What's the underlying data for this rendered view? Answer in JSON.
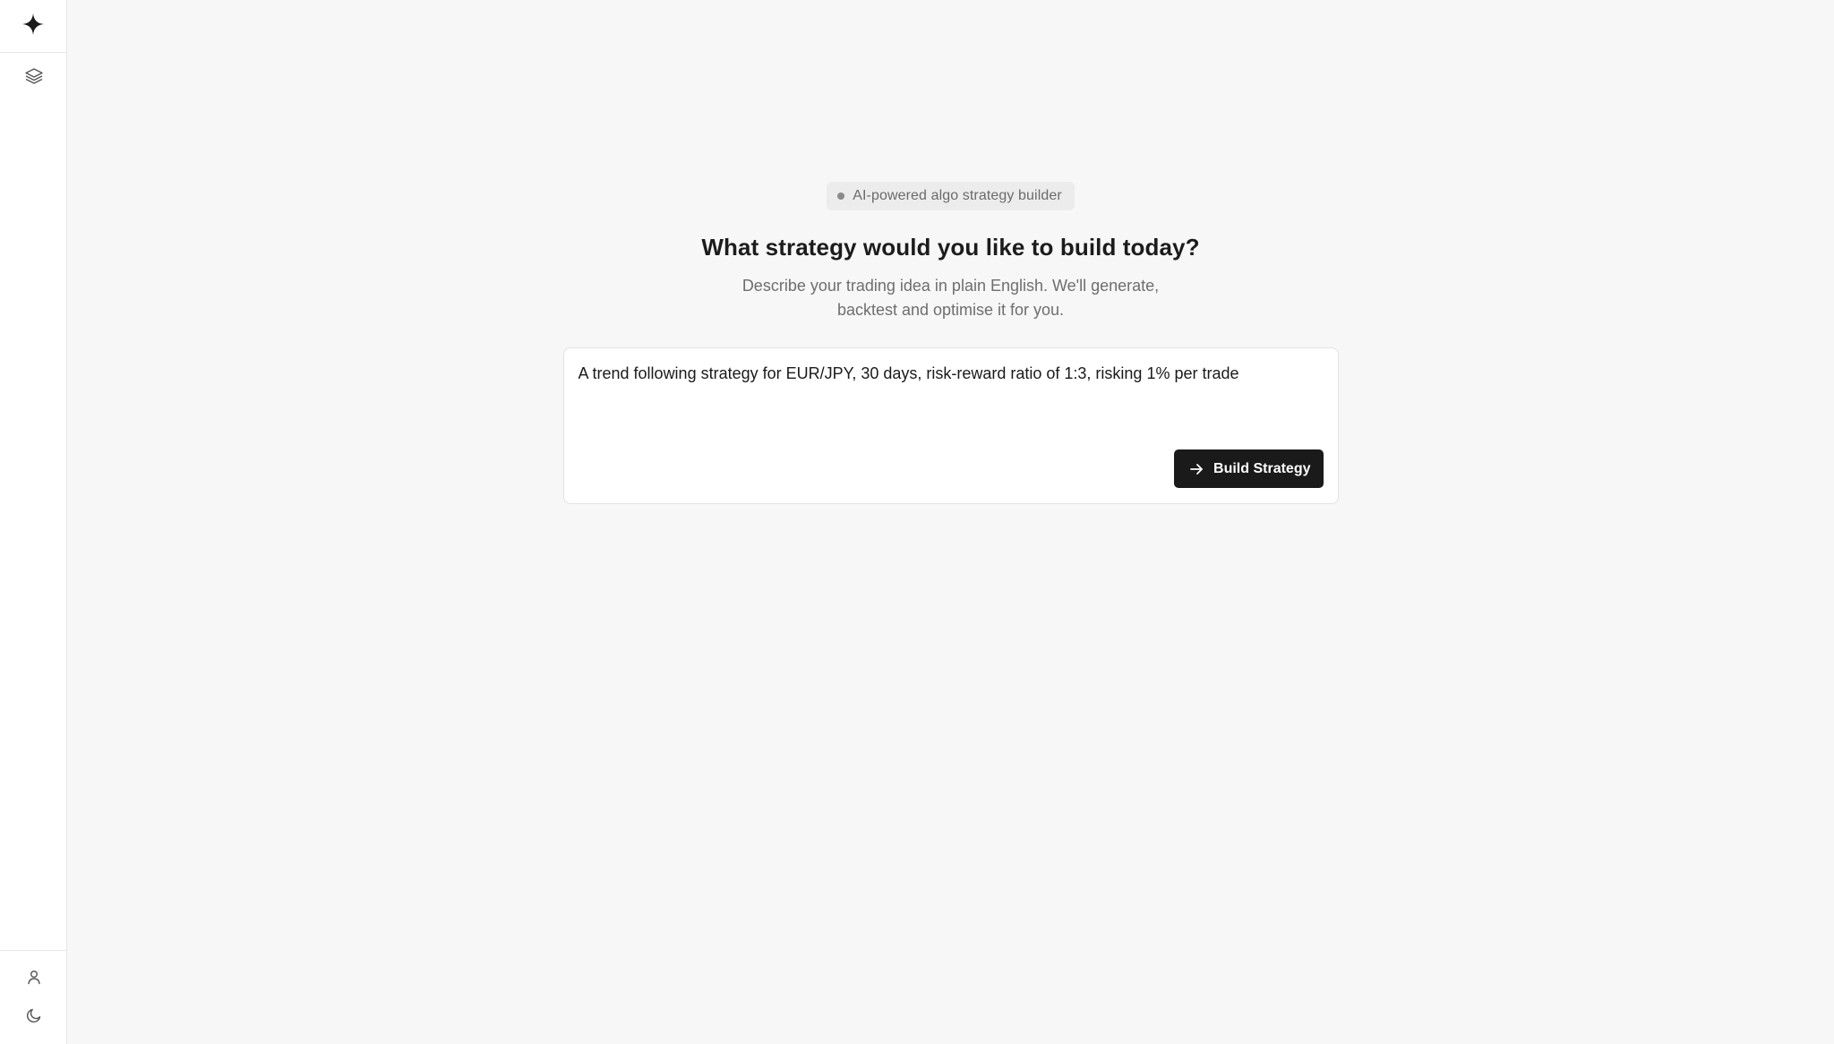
{
  "sidebar": {
    "logo_icon": "sparkle-icon",
    "nav_items": [
      {
        "icon": "layers-icon"
      }
    ],
    "bottom_items": [
      {
        "icon": "user-icon"
      },
      {
        "icon": "moon-icon"
      }
    ]
  },
  "hero": {
    "badge": "AI-powered algo strategy builder",
    "title": "What strategy would you like to build today?",
    "subtitle": "Describe your trading idea in plain English. We'll generate, backtest and optimise it for you."
  },
  "prompt": {
    "value": "A trend following strategy for EUR/JPY, 30 days, risk-reward ratio of 1:3, risking 1% per trade",
    "submit_label": "Build Strategy",
    "submit_icon": "arrow-right-icon"
  },
  "colors": {
    "background": "#f7f7f7",
    "sidebar": "#ffffff",
    "button": "#1a1a1a",
    "badge": "#ececec"
  }
}
